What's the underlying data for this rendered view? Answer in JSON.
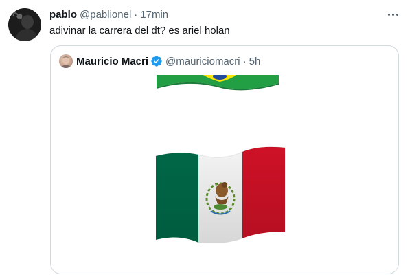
{
  "tweet": {
    "author_name": "pablo",
    "author_handle": "@pablionel",
    "separator": "·",
    "time": "17min",
    "text": "adivinar la carrera del dt? es ariel holan"
  },
  "quote": {
    "author_name": "Mauricio Macri",
    "author_handle": "@mauriciomacri",
    "separator": "·",
    "time": "5h"
  },
  "icons": {
    "more": "more-icon",
    "verified": "verified-badge-icon",
    "flag_top": "brazil-flag-emoji",
    "flag_main": "mexico-flag-emoji"
  },
  "colors": {
    "text_primary": "#0f1419",
    "text_secondary": "#536471",
    "border": "#cfd9de",
    "verified_blue": "#1d9bf0",
    "flag_green": "#006847",
    "flag_red": "#ce1126",
    "brazil_green": "#229e45",
    "brazil_yellow": "#f8e509"
  }
}
